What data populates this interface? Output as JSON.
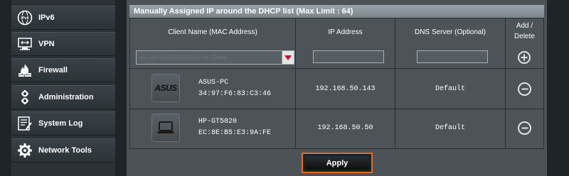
{
  "sidebar": {
    "items": [
      {
        "label": "IPv6",
        "icon": "ipv6-icon"
      },
      {
        "label": "VPN",
        "icon": "vpn-icon"
      },
      {
        "label": "Firewall",
        "icon": "firewall-icon"
      },
      {
        "label": "Administration",
        "icon": "administration-icon"
      },
      {
        "label": "System Log",
        "icon": "system-log-icon"
      },
      {
        "label": "Network Tools",
        "icon": "network-tools-icon"
      }
    ]
  },
  "section": {
    "title": "Manually Assigned IP around the DHCP list (Max Limit : 64)"
  },
  "table": {
    "headers": {
      "client": "Client Name (MAC Address)",
      "ip": "IP Address",
      "dns": "DNS Server (Optional)",
      "add_delete_1": "Add /",
      "add_delete_2": "Delete"
    },
    "new_row": {
      "client_placeholder": "ex: 00:00:00:00:00:00 or Client",
      "ip_value": "",
      "dns_value": ""
    },
    "rows": [
      {
        "name": "ASUS-PC",
        "mac": "34:97:F6:83:C3:46",
        "ip": "192.168.50.143",
        "dns": "Default",
        "device_icon": "asus-logo-icon"
      },
      {
        "name": "HP-GT5820",
        "mac": "EC:8E:B5:E3:9A:FE",
        "ip": "192.168.50.50",
        "dns": "Default",
        "device_icon": "laptop-icon"
      }
    ]
  },
  "actions": {
    "apply_label": "Apply"
  },
  "colors": {
    "accent": "#e36b23",
    "dropdown_arrow": "#c8102e"
  }
}
